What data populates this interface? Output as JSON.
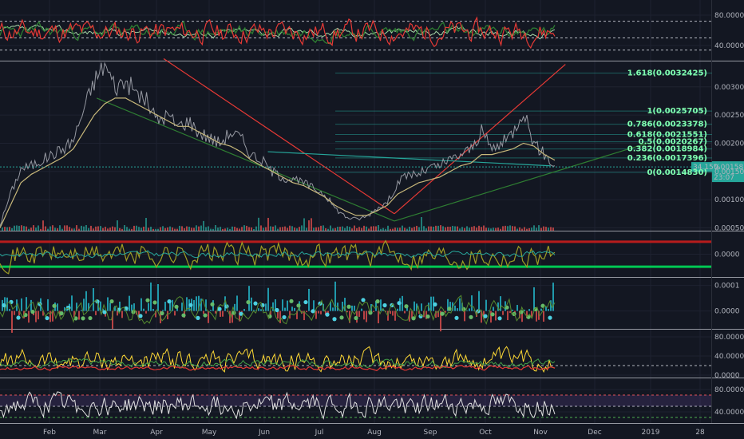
{
  "chart_data": {
    "type": "line",
    "x_axis": {
      "ticks": [
        "Feb",
        "Mar",
        "Apr",
        "May",
        "Jun",
        "Jul",
        "Aug",
        "Sep",
        "Oct",
        "Nov",
        "Dec",
        "2019",
        "28"
      ]
    },
    "panes": [
      {
        "id": "stoch-rsi",
        "y_ticks": [
          "80.0000",
          "40.0000"
        ],
        "y_values": [
          80,
          40
        ],
        "ylim": [
          20,
          100
        ],
        "guides": [
          72,
          50,
          34
        ]
      },
      {
        "id": "price",
        "y_ticks": [
          "0.0030000",
          "0.0025000",
          "0.0020000",
          "0.0015000",
          "0.0010000",
          "0.0005000"
        ],
        "y_values": [
          0.003,
          0.0025,
          0.002,
          0.0015,
          0.001,
          0.0005
        ],
        "ylim": [
          0.00045,
          0.00345
        ],
        "current_price": "0.0015810",
        "price_badge": "0.0015810",
        "timer_badge": "23:07",
        "small_badge": "34.15%",
        "fib_levels": [
          {
            "label": "1.618(0.0032425)",
            "value": 0.0032425
          },
          {
            "label": "1(0.0025705)",
            "value": 0.0025705
          },
          {
            "label": "0.786(0.0023378)",
            "value": 0.0023378
          },
          {
            "label": "0.618(0.0021551)",
            "value": 0.0021551
          },
          {
            "label": "0.5(0.0020267)",
            "value": 0.0020267
          },
          {
            "label": "0.382(0.0018984)",
            "value": 0.0018984
          },
          {
            "label": "0.236(0.0017396)",
            "value": 0.0017396
          },
          {
            "label": "0(0.0014830)",
            "value": 0.001483
          }
        ],
        "series": [
          {
            "values": [
              0.00055,
              0.0011,
              0.00155,
              0.0016,
              0.0017,
              0.0018,
              0.0019,
              0.00205,
              0.0026,
              0.0031,
              0.0034,
              0.003,
              0.0031,
              0.0029,
              0.00275,
              0.0024,
              0.0025,
              0.0023,
              0.0024,
              0.0022,
              0.0021,
              0.002,
              0.0022,
              0.0021,
              0.0018,
              0.0017,
              0.0015,
              0.0014,
              0.00135,
              0.0013,
              0.0012,
              0.0011,
              0.00085,
              0.0007,
              0.00065,
              0.0007,
              0.00085,
              0.00095,
              0.0013,
              0.00145,
              0.00145,
              0.00155,
              0.0016,
              0.0017,
              0.0018,
              0.0019,
              0.0022,
              0.0019,
              0.002,
              0.0022,
              0.0026,
              0.002,
              0.0018,
              0.0016
            ],
            "color": "#9598a1"
          },
          {
            "values": [
              0.0005,
              0.0009,
              0.0013,
              0.00145,
              0.00155,
              0.00165,
              0.00175,
              0.0019,
              0.0022,
              0.0025,
              0.0027,
              0.0028,
              0.0028,
              0.0027,
              0.0026,
              0.0025,
              0.0024,
              0.0023,
              0.0023,
              0.0022,
              0.0021,
              0.002,
              0.00195,
              0.00185,
              0.0017,
              0.0016,
              0.0015,
              0.0014,
              0.0013,
              0.00125,
              0.00115,
              0.00105,
              0.0009,
              0.0008,
              0.00072,
              0.00072,
              0.0008,
              0.0009,
              0.0011,
              0.0012,
              0.0013,
              0.00135,
              0.0014,
              0.0015,
              0.0016,
              0.00165,
              0.0018,
              0.0018,
              0.00185,
              0.0019,
              0.002,
              0.00195,
              0.0018,
              0.0017
            ],
            "color": "#c8b87a"
          }
        ],
        "trendlines": [
          {
            "color": "#e53935",
            "points": [
              [
                0.22,
                0.0035
              ],
              [
                0.53,
                0.00075
              ]
            ]
          },
          {
            "color": "#e53935",
            "points": [
              [
                0.53,
                0.00075
              ],
              [
                0.76,
                0.0034
              ]
            ]
          },
          {
            "color": "#2e7d32",
            "points": [
              [
                0.13,
                0.0028
              ],
              [
                0.53,
                0.00062
              ]
            ]
          },
          {
            "color": "#2e7d32",
            "points": [
              [
                0.53,
                0.00062
              ],
              [
                0.87,
                0.002
              ]
            ]
          },
          {
            "color": "#26a69a",
            "points": [
              [
                0.36,
                0.00185
              ],
              [
                0.74,
                0.0016
              ]
            ]
          }
        ]
      },
      {
        "id": "oscillator",
        "y_ticks": [
          "0.0000"
        ],
        "y_values": [
          0
        ],
        "ylim": [
          -1,
          1
        ],
        "guides": [
          0.55,
          -0.55
        ]
      },
      {
        "id": "macd-histogram",
        "y_ticks": [
          "0.0001",
          "0.0000"
        ],
        "y_values": [
          0.0001,
          0
        ],
        "ylim": [
          -7e-05,
          0.00013
        ]
      },
      {
        "id": "adx-dmi",
        "y_ticks": [
          "80.0000",
          "40.0000",
          "0.0000"
        ],
        "y_values": [
          80,
          40,
          0
        ],
        "ylim": [
          -5,
          95
        ],
        "guides": [
          20
        ]
      },
      {
        "id": "rsi",
        "y_ticks": [
          "80.0000",
          "40.0000"
        ],
        "y_values": [
          80,
          40
        ],
        "ylim": [
          20,
          100
        ],
        "guides": [
          70,
          50,
          30
        ],
        "band": [
          50,
          70
        ]
      }
    ]
  }
}
